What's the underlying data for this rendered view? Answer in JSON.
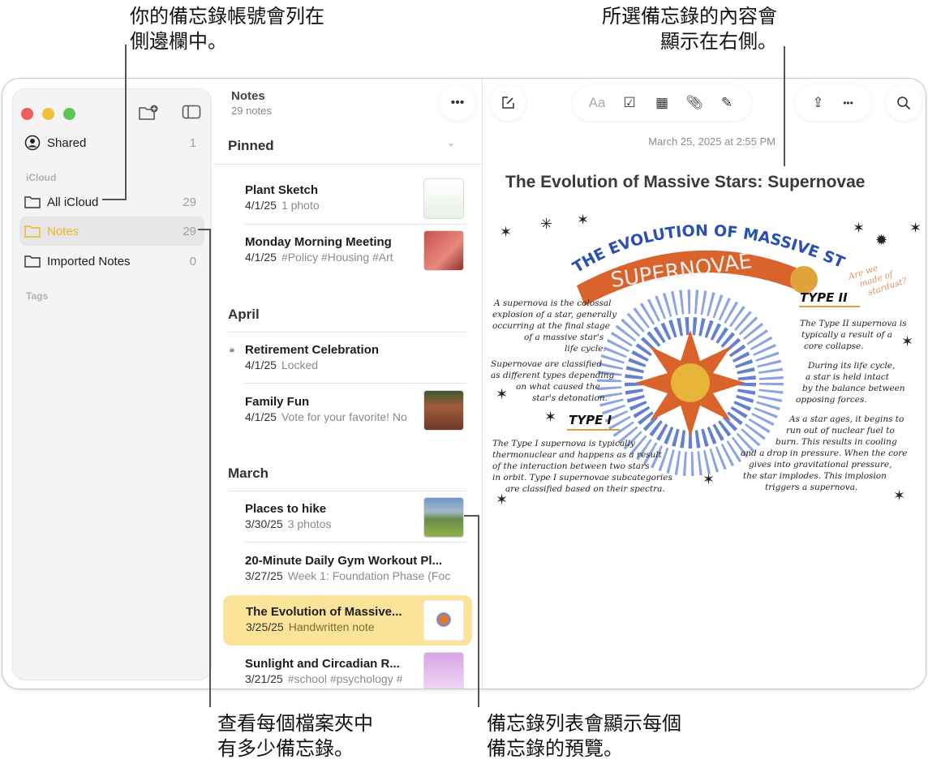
{
  "callouts": {
    "sidebar": [
      "你的備忘錄帳號會列在",
      "側邊欄中。"
    ],
    "content": [
      "所選備忘錄的內容會",
      "顯示在右側。"
    ],
    "counts": [
      "查看每個檔案夾中",
      "有多少備忘錄。"
    ],
    "list": [
      "備忘錄列表會顯示每個",
      "備忘錄的預覽。"
    ]
  },
  "sidebar": {
    "shared": {
      "label": "Shared",
      "count": "1"
    },
    "section_icloud": "iCloud",
    "folders": [
      {
        "label": "All iCloud",
        "count": "29"
      },
      {
        "label": "Notes",
        "count": "29"
      },
      {
        "label": "Imported Notes",
        "count": "0"
      }
    ],
    "section_tags": "Tags"
  },
  "list": {
    "title": "Notes",
    "subtitle": "29 notes",
    "more": "•••",
    "sections": [
      "Pinned",
      "April",
      "March"
    ],
    "notes": [
      {
        "title": "Plant Sketch",
        "date": "4/1/25",
        "preview": "1 photo"
      },
      {
        "title": "Monday Morning Meeting",
        "date": "4/1/25",
        "preview": "#Policy #Housing #Art"
      },
      {
        "title": "Retirement Celebration",
        "date": "4/1/25",
        "preview": "Locked"
      },
      {
        "title": "Family Fun",
        "date": "4/1/25",
        "preview": "Vote for your favorite! No"
      },
      {
        "title": "Places to hike",
        "date": "3/30/25",
        "preview": "3 photos"
      },
      {
        "title": "20-Minute Daily Gym Workout Pl...",
        "date": "3/27/25",
        "preview": "Week 1: Foundation Phase (Foc"
      },
      {
        "title": "The Evolution of Massive...",
        "date": "3/25/25",
        "preview": "Handwritten note"
      },
      {
        "title": "Sunlight and Circadian R...",
        "date": "3/21/25",
        "preview": "#school #psychology #"
      }
    ]
  },
  "editor": {
    "format_label": "Aa",
    "more": "•••",
    "date": "March 25, 2025 at 2:55 PM",
    "title": "The Evolution of Massive Stars: Supernovae",
    "drawing": {
      "arc_title": "THE EVOLUTION OF MASSIVE STARS:",
      "banner": "SUPERNOVAE",
      "aside": [
        "Are we",
        "made of",
        "stardust?"
      ],
      "type1": "TYPE I",
      "type2": "TYPE II",
      "p1": [
        "A supernova is the colossal",
        "explosion of a star, generally",
        "occurring at the final stage",
        "of a massive star's",
        "life cycle."
      ],
      "p2": [
        "Supernovae are classified",
        "as different types depending",
        "on what caused the",
        "star's detonation."
      ],
      "p3": [
        "The Type I supernova is typically",
        "thermonuclear and happens as a result",
        "of the interaction between two stars",
        "in orbit. Type I supernovae subcategories",
        "are classified based on their spectra."
      ],
      "p4": [
        "The Type II supernova is",
        "typically a result of a",
        "core collapse."
      ],
      "p5": [
        "During its life cycle,",
        "a star is held intact",
        "by the balance between",
        "opposing forces."
      ],
      "p6": [
        "As a star ages, it begins to",
        "run out of nuclear fuel to",
        "burn. This results in cooling",
        "and a drop in pressure. When the core",
        "gives into gravitational pressure,",
        "the star implodes. This implosion",
        "triggers a supernova."
      ]
    }
  },
  "colors": {
    "accent": "#f5b400",
    "selected": "#fbe49a",
    "banner": "#d9632a",
    "blue": "#2a50b0"
  }
}
